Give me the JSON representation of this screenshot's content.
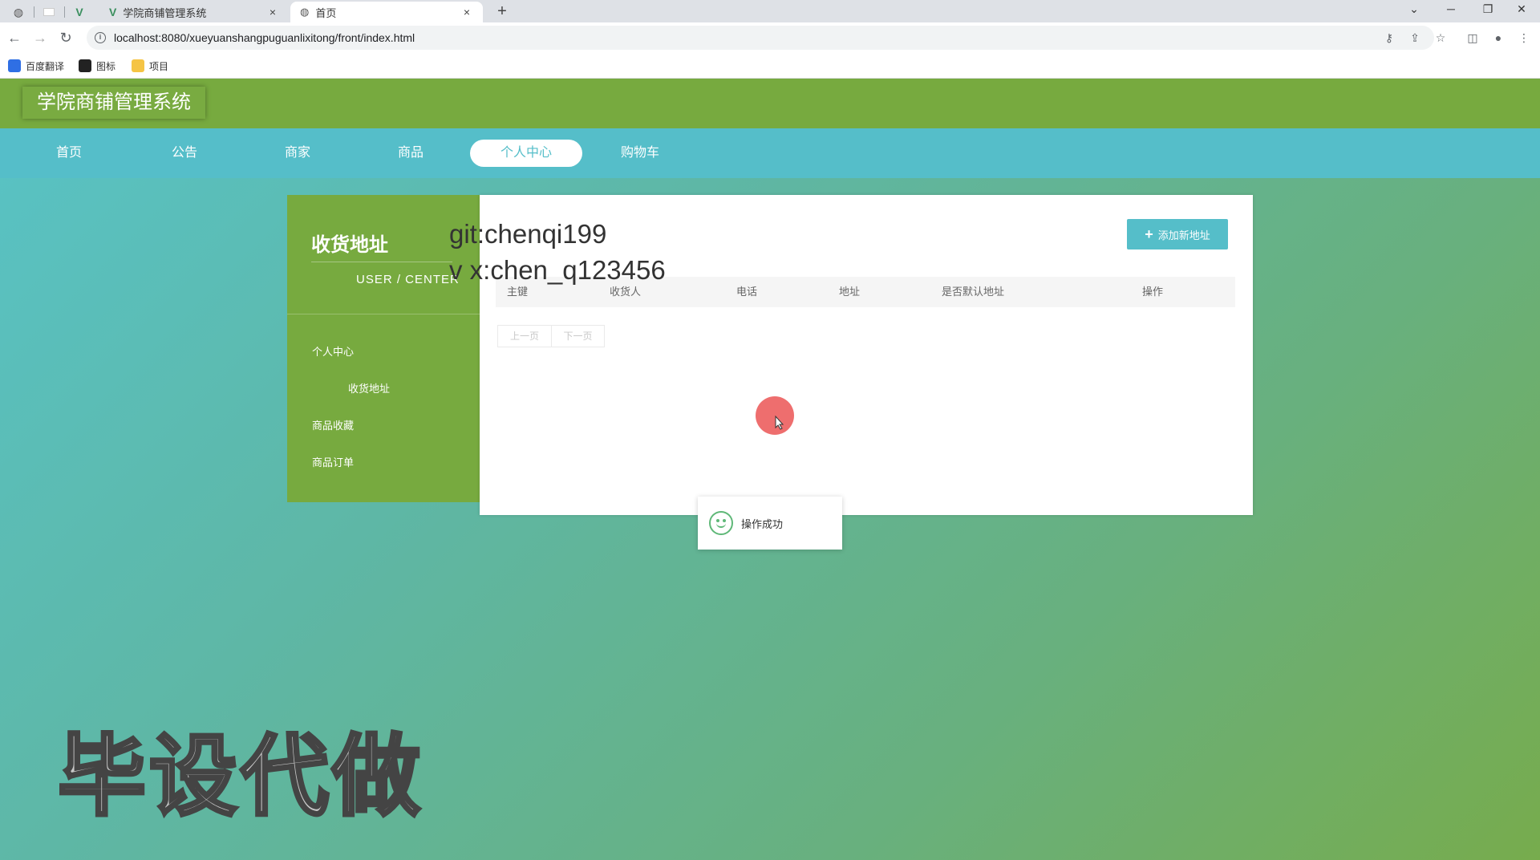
{
  "browser": {
    "tabs": [
      {
        "title": "学院商铺管理系统",
        "close": "×"
      },
      {
        "title": "首页",
        "close": "×"
      }
    ],
    "new_tab": "+",
    "window_controls": {
      "minimize": "─",
      "restore": "❐",
      "close": "✕",
      "tablist": "⌄"
    },
    "nav": {
      "back": "←",
      "forward": "→",
      "reload": "↻"
    },
    "url": "localhost:8080/xueyuanshangpuguanlixitong/front/index.html",
    "bookmarks": [
      {
        "label": "百度翻译",
        "color": "#2f6fe4"
      },
      {
        "label": "图标",
        "color": "#222222"
      },
      {
        "label": "项目",
        "color": "#f5c445"
      }
    ]
  },
  "site": {
    "title": "学院商铺管理系统",
    "nav": [
      "首页",
      "公告",
      "商家",
      "商品",
      "个人中心",
      "购物车"
    ],
    "active_nav": "个人中心"
  },
  "sidebar": {
    "title": "收货地址",
    "subtitle": "USER / CENTER",
    "items": [
      "个人中心",
      "收货地址",
      "商品收藏",
      "商品订单"
    ]
  },
  "content": {
    "add_button": "添加新地址",
    "add_icon": "+",
    "table_headers": [
      "主键",
      "收货人",
      "电话",
      "地址",
      "是否默认地址",
      "操作"
    ],
    "pager": {
      "prev": "上一页",
      "next": "下一页"
    }
  },
  "overlay": {
    "line1": "git:chenqi199",
    "line2": "v x:chen_q123456"
  },
  "toast": {
    "message": "操作成功"
  },
  "watermark": "毕设代做",
  "colors": {
    "header_green": "#77aa3f",
    "nav_teal": "#55bec9",
    "accent": "#55bec9"
  }
}
